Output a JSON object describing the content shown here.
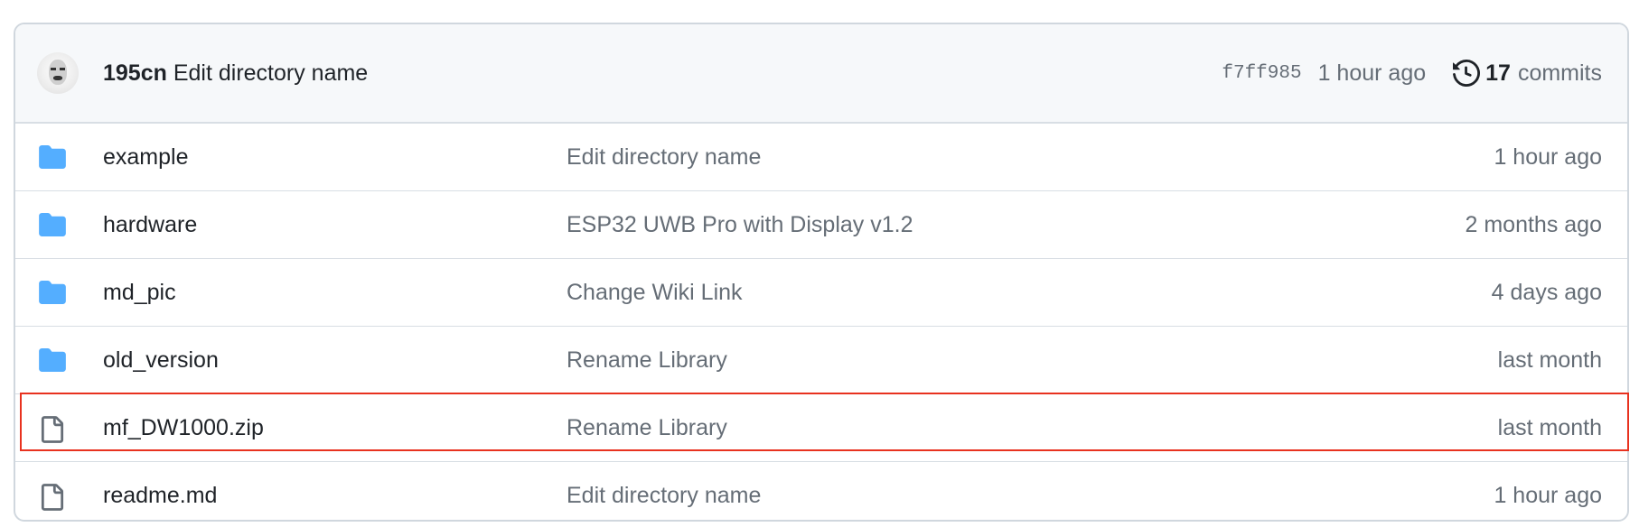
{
  "latest_commit": {
    "author": "195cn",
    "message": "Edit directory name",
    "sha": "f7ff985",
    "time": "1 hour ago",
    "commit_count": "17",
    "commits_label": "commits"
  },
  "files": [
    {
      "type": "folder",
      "name": "example",
      "message": "Edit directory name",
      "date": "1 hour ago"
    },
    {
      "type": "folder",
      "name": "hardware",
      "message": "ESP32 UWB Pro with Display v1.2",
      "date": "2 months ago"
    },
    {
      "type": "folder",
      "name": "md_pic",
      "message": "Change Wiki Link",
      "date": "4 days ago"
    },
    {
      "type": "folder",
      "name": "old_version",
      "message": "Rename Library",
      "date": "last month"
    },
    {
      "type": "file",
      "name": "mf_DW1000.zip",
      "message": "Rename Library",
      "date": "last month",
      "highlighted": true
    },
    {
      "type": "file",
      "name": "readme.md",
      "message": "Edit directory name",
      "date": "1 hour ago"
    }
  ],
  "colors": {
    "folder": "#54aeff",
    "highlight": "#e8321f",
    "muted": "#656d76"
  }
}
